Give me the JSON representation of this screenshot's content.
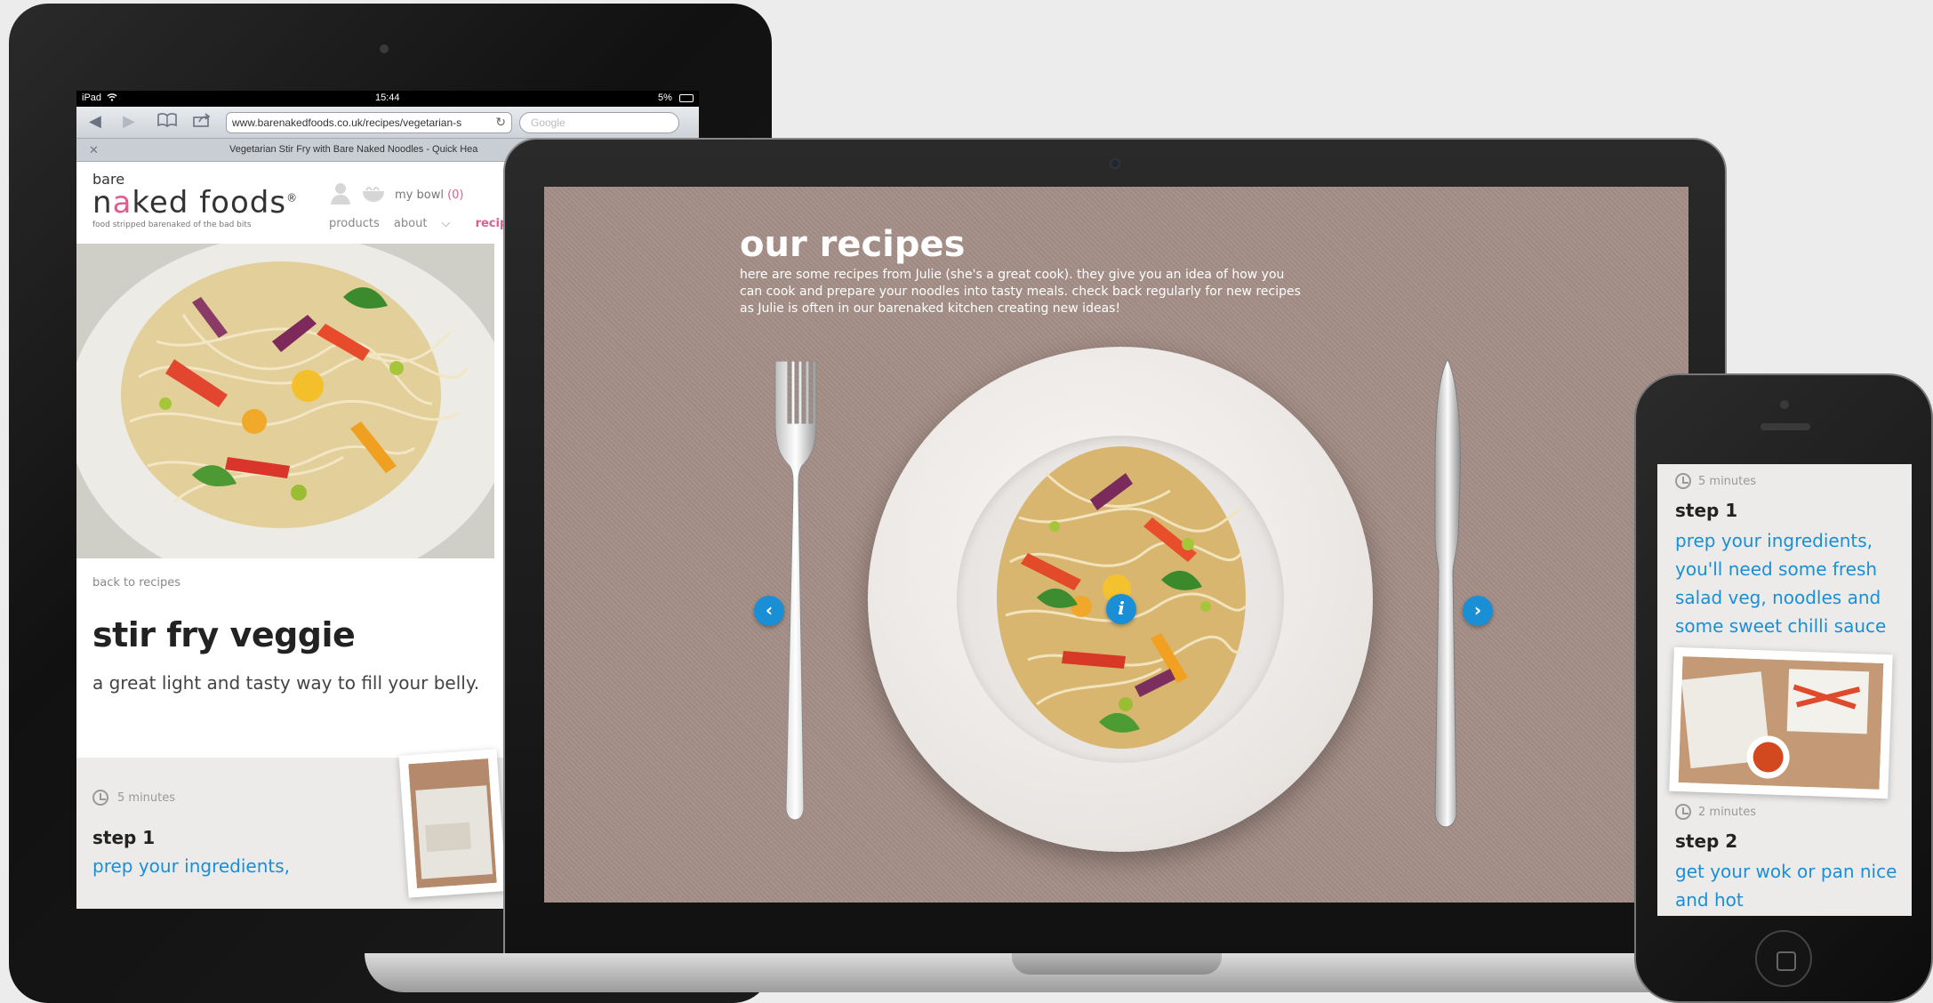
{
  "ipad": {
    "status": {
      "carrier": "iPad",
      "time": "15:44",
      "battery": "5%"
    },
    "browser": {
      "url": "www.barenakedfoods.co.uk/recipes/vegetarian-s",
      "search_placeholder": "Google",
      "tab_title": "Vegetarian Stir Fry with Bare Naked Noodles - Quick Hea"
    },
    "site": {
      "logo_top": "bare",
      "logo_main_pre": "n",
      "logo_main_accent": "a",
      "logo_main_post": "ked foods",
      "logo_mark": "®",
      "logo_tagline": "food stripped barenaked of the bad bits",
      "bowl_label": "my bowl",
      "bowl_count": "(0)",
      "nav": {
        "products": "products",
        "about": "about",
        "about_caret": "⌵",
        "recipes": "recipes"
      },
      "back_link": "back to recipes",
      "recipe_title": "stir fry veggie",
      "recipe_subtitle": "a great light and tasty way to fill your belly.",
      "step": {
        "duration": "5 minutes",
        "heading": "step 1",
        "text": "prep your ingredients,"
      }
    }
  },
  "macbook": {
    "title": "our recipes",
    "intro": "here are some recipes from Julie (she's a great cook). they give you an idea of how you can cook and prepare your noodles into tasty meals. check back regularly for new recipes as Julie is often in our barenaked kitchen creating new ideas!",
    "prev_label": "‹",
    "next_label": "›",
    "info_label": "i"
  },
  "iphone": {
    "step1": {
      "duration": "5 minutes",
      "heading": "step 1",
      "text": "prep your ingredients, you'll need some fresh salad veg, noodles and some sweet chilli sauce"
    },
    "step2": {
      "duration": "2 minutes",
      "heading": "step 2",
      "text": "get your wok or pan nice and hot"
    }
  },
  "colors": {
    "accent_blue": "#1a8fd6",
    "accent_pink": "#e05b8f",
    "canvas": "#a48f87"
  }
}
